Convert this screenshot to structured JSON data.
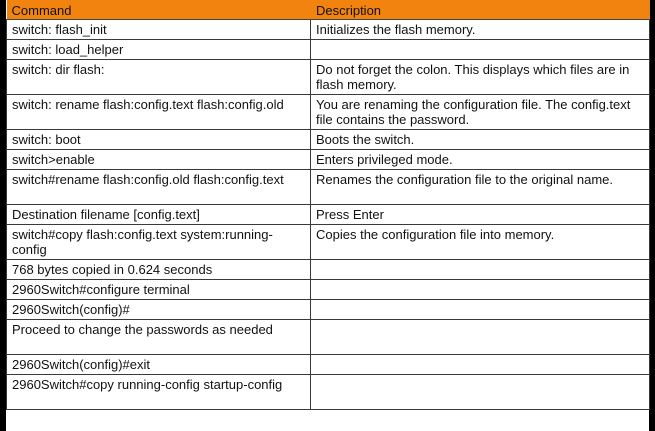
{
  "table": {
    "headers": [
      "Command",
      "Description"
    ],
    "rows": [
      {
        "command": "switch: flash_init",
        "description": "Initializes the flash memory."
      },
      {
        "command": "switch: load_helper",
        "description": ""
      },
      {
        "command": "switch: dir flash:",
        "description": "Do not forget the colon. This displays which files are in flash memory."
      },
      {
        "command": "switch: rename flash:config.text flash:config.old",
        "description": "You are renaming the configuration file. The config.text file contains the password."
      },
      {
        "command": "switch: boot",
        "description": "Boots the switch."
      },
      {
        "command": "switch>enable",
        "description": "Enters privileged mode."
      },
      {
        "command": "switch#rename flash:config.old flash:config.text",
        "description": "Renames the configuration file to the original name."
      },
      {
        "command": "Destination filename [config.text]",
        "description": "Press Enter"
      },
      {
        "command": "switch#copy flash:config.text system:running-config",
        "description": "Copies the configuration file into memory."
      },
      {
        "command": "768 bytes copied in 0.624 seconds",
        "description": ""
      },
      {
        "command": "2960Switch#configure terminal",
        "description": ""
      },
      {
        "command": "2960Switch(config)#",
        "description": ""
      },
      {
        "command": "Proceed to change the passwords as needed",
        "description": ""
      },
      {
        "command": "2960Switch(config)#exit",
        "description": ""
      },
      {
        "command": "2960Switch#copy running-config startup-config",
        "description": ""
      }
    ]
  }
}
